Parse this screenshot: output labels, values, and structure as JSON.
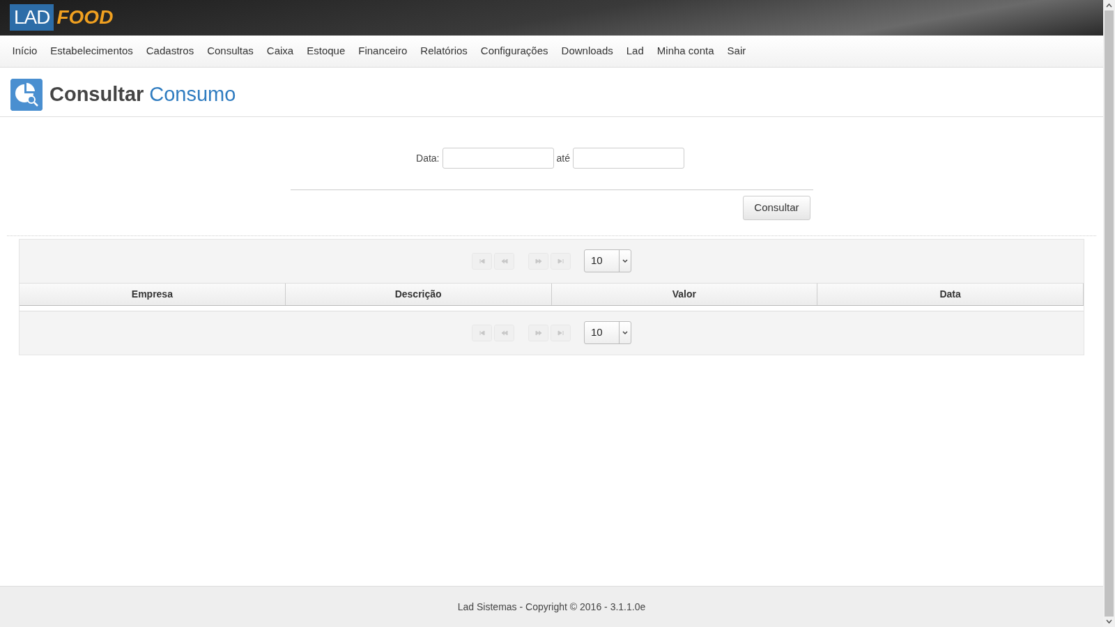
{
  "logo": {
    "part_1": "LAD",
    "part_2": "FOOD"
  },
  "menu": [
    "Início",
    "Estabelecimentos",
    "Cadastros",
    "Consultas",
    "Caixa",
    "Estoque",
    "Financeiro",
    "Relatórios",
    "Configurações",
    "Downloads",
    "Lad",
    "Minha conta",
    "Sair"
  ],
  "page_title": {
    "verb": "Consultar",
    "subject": "Consumo"
  },
  "filter": {
    "date_label": "Data:",
    "between_label": "até",
    "button": "Consultar"
  },
  "paginators": [
    {
      "page_size": "10",
      "nav_disabled": true
    },
    {
      "page_size": "10",
      "nav_disabled": true
    }
  ],
  "table": {
    "columns": [
      "Empresa",
      "Descrição",
      "Valor",
      "Data"
    ]
  },
  "footer": "Lad Sistemas - Copyright © 2016 - 3.1.1.0e"
}
